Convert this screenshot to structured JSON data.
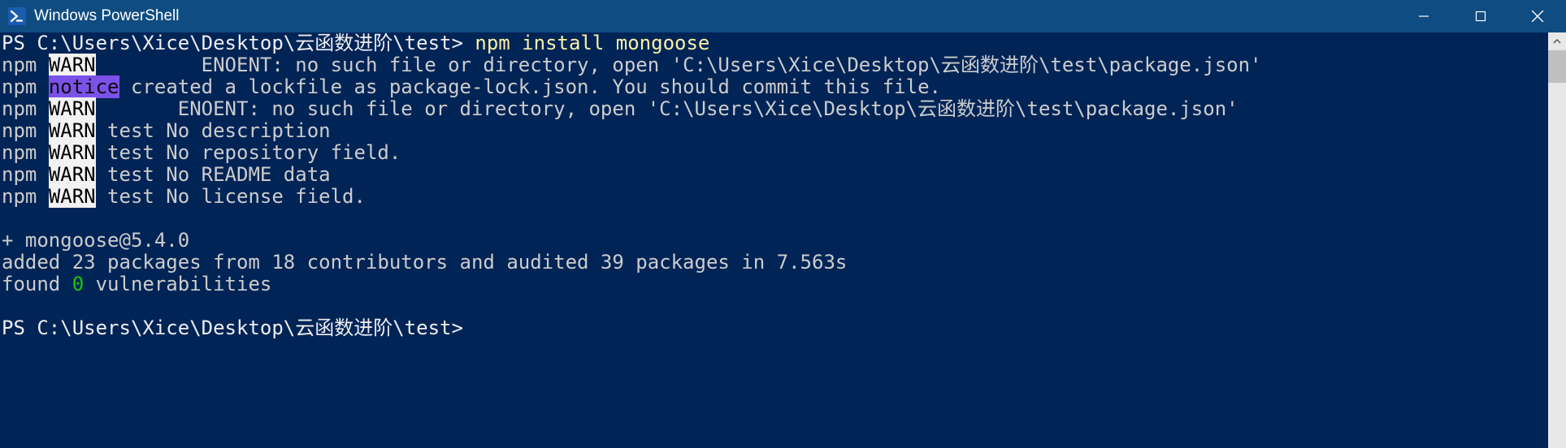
{
  "titlebar": {
    "title": "Windows PowerShell"
  },
  "terminal": {
    "prompt1_path": "PS C:\\Users\\Xice\\Desktop\\云函数进阶\\test> ",
    "command": "npm install mongoose",
    "npm_prefix": "npm",
    "warn_label": "WARN",
    "notice_label": "notice",
    "line1_rest": "         ENOENT: no such file or directory, open 'C:\\Users\\Xice\\Desktop\\云函数进阶\\test\\package.json'",
    "line2_rest": " created a lockfile as package-lock.json. You should commit this file.",
    "line3_rest": "       ENOENT: no such file or directory, open 'C:\\Users\\Xice\\Desktop\\云函数进阶\\test\\package.json'",
    "line4_rest": " test No description",
    "line5_rest": " test No repository field.",
    "line6_rest": " test No README data",
    "line7_rest": " test No license field.",
    "blank": " ",
    "installed_line": "+ mongoose@5.4.0",
    "added_line": "added 23 packages from 18 contributors and audited 39 packages in 7.563s",
    "found_prefix": "found ",
    "vuln_count": "0",
    "found_suffix": " vulnerabilities",
    "prompt2_path": "PS C:\\Users\\Xice\\Desktop\\云函数进阶\\test> "
  }
}
